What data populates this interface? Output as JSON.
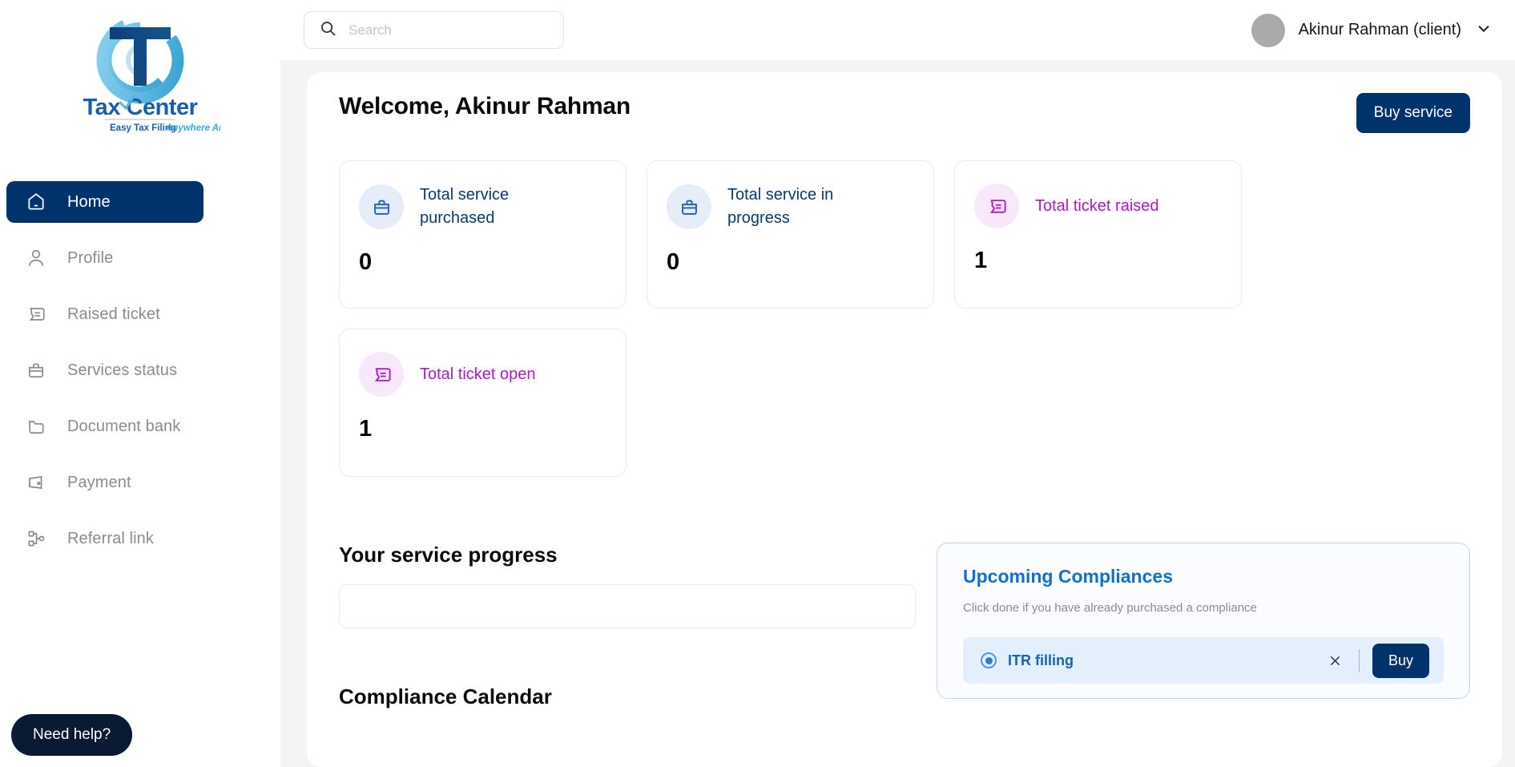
{
  "brand": {
    "name": "Tax Center",
    "name_part1": "Ta",
    "name_part2": "x",
    "name_part3": " Center",
    "tagline_bold": "Easy Tax Filing",
    "tagline_italic": "Anywhere Anytime",
    "colors": {
      "dark_blue": "#0c3b70",
      "light_blue": "#6fc3e8",
      "navy": "#00336b"
    }
  },
  "sidebar": {
    "items": [
      {
        "label": "Home",
        "icon": "home-icon",
        "active": true
      },
      {
        "label": "Profile",
        "icon": "user-icon",
        "active": false
      },
      {
        "label": "Raised ticket",
        "icon": "ticket-icon",
        "active": false
      },
      {
        "label": "Services status",
        "icon": "briefcase-icon",
        "active": false
      },
      {
        "label": "Document bank",
        "icon": "folder-icon",
        "active": false
      },
      {
        "label": "Payment",
        "icon": "wallet-icon",
        "active": false
      },
      {
        "label": "Referral link",
        "icon": "share-nodes-icon",
        "active": false
      }
    ],
    "need_help_label": "Need help?"
  },
  "topbar": {
    "search": {
      "placeholder": "Search",
      "value": "",
      "icon": "search-icon"
    },
    "user": {
      "name": "Akinur Rahman (client)",
      "avatar": "avatar",
      "chevron": "chevron-down-icon"
    }
  },
  "main": {
    "welcome_title": "Welcome, Akinur Rahman",
    "buy_service_label": "Buy service",
    "stats": [
      {
        "label": "Total service purchased",
        "value": "0",
        "icon": "briefcase-icon",
        "accent": "blue",
        "accent_hex": "#1f5fcf"
      },
      {
        "label": "Total service in progress",
        "value": "0",
        "icon": "briefcase-icon",
        "accent": "blue",
        "accent_hex": "#1f5fcf"
      },
      {
        "label": "Total ticket raised",
        "value": "1",
        "icon": "ticket-icon",
        "accent": "purple",
        "accent_hex": "#ae17cd"
      },
      {
        "label": "Total ticket open",
        "value": "1",
        "icon": "ticket-icon",
        "accent": "purple",
        "accent_hex": "#ae17cd"
      }
    ],
    "service_progress": {
      "title": "Your service progress",
      "items": []
    },
    "compliance_calendar": {
      "title": "Compliance Calendar"
    },
    "upcoming_compliances": {
      "title": "Upcoming Compliances",
      "subtitle": "Click done if you have already purchased a compliance",
      "rows": [
        {
          "name": "ITR filling",
          "selected": true,
          "dismiss_icon": "close-icon",
          "buy_label": "Buy"
        }
      ]
    }
  }
}
